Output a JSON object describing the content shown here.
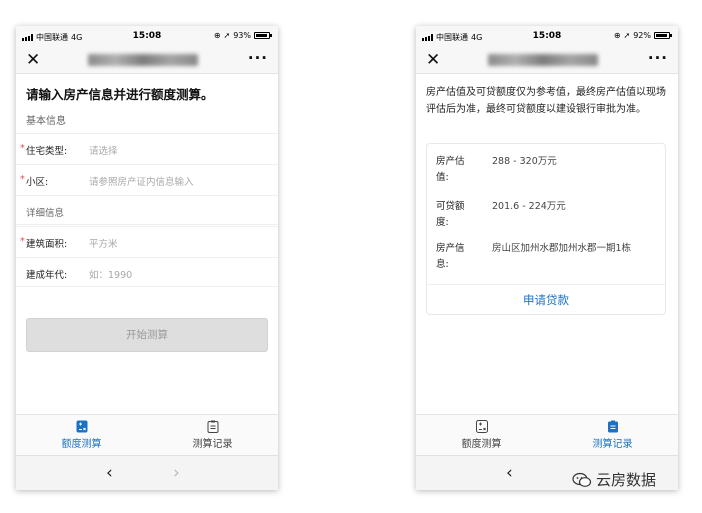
{
  "status_bar": {
    "left": {
      "carrier": "中国联通",
      "network": "4G",
      "time": "15:08",
      "battery_text": "93%",
      "battery_fraction": 0.93
    },
    "right": {
      "carrier": "中国联通",
      "network": "4G",
      "time": "15:08",
      "battery_text": "92%",
      "battery_fraction": 0.92
    }
  },
  "nav": {
    "close_glyph": "✕",
    "more_glyph": "···"
  },
  "calc_page": {
    "heading": "请输入房产信息并进行额度测算。",
    "section_basic": "基本信息",
    "field_house_type": {
      "required_mark": "*",
      "label": "住宅类型:",
      "placeholder": "请选择"
    },
    "field_community": {
      "required_mark": "*",
      "label": "小区:",
      "placeholder": "请参照房产证内信息输入"
    },
    "section_detail": "详细信息",
    "field_area": {
      "required_mark": "*",
      "label": "建筑面积:",
      "placeholder": "平方米"
    },
    "field_year": {
      "label": "建成年代:",
      "placeholder": "如：1990"
    },
    "submit_label": "开始测算"
  },
  "result_page": {
    "notice": "房产估值及可贷额度仅为参考值，最终房产估值以现场评估后为准，最终可贷额度以建设银行审批为准。",
    "valuation": {
      "label": "房产估值:",
      "value": "288 - 320万元"
    },
    "loan_amount": {
      "label": "可贷额度:",
      "value": "201.6 - 224万元"
    },
    "property_info": {
      "label": "房产信息:",
      "value": "房山区加州水郡加州水郡一期1栋"
    },
    "apply_label": "申请贷款"
  },
  "tabs": {
    "calc": "额度测算",
    "records": "测算记录"
  },
  "browser": {
    "back": "‹",
    "forward": "›"
  },
  "watermark": {
    "text": "云房数据"
  },
  "colors": {
    "accent": "#1a72c6",
    "required": "#d9534f"
  }
}
